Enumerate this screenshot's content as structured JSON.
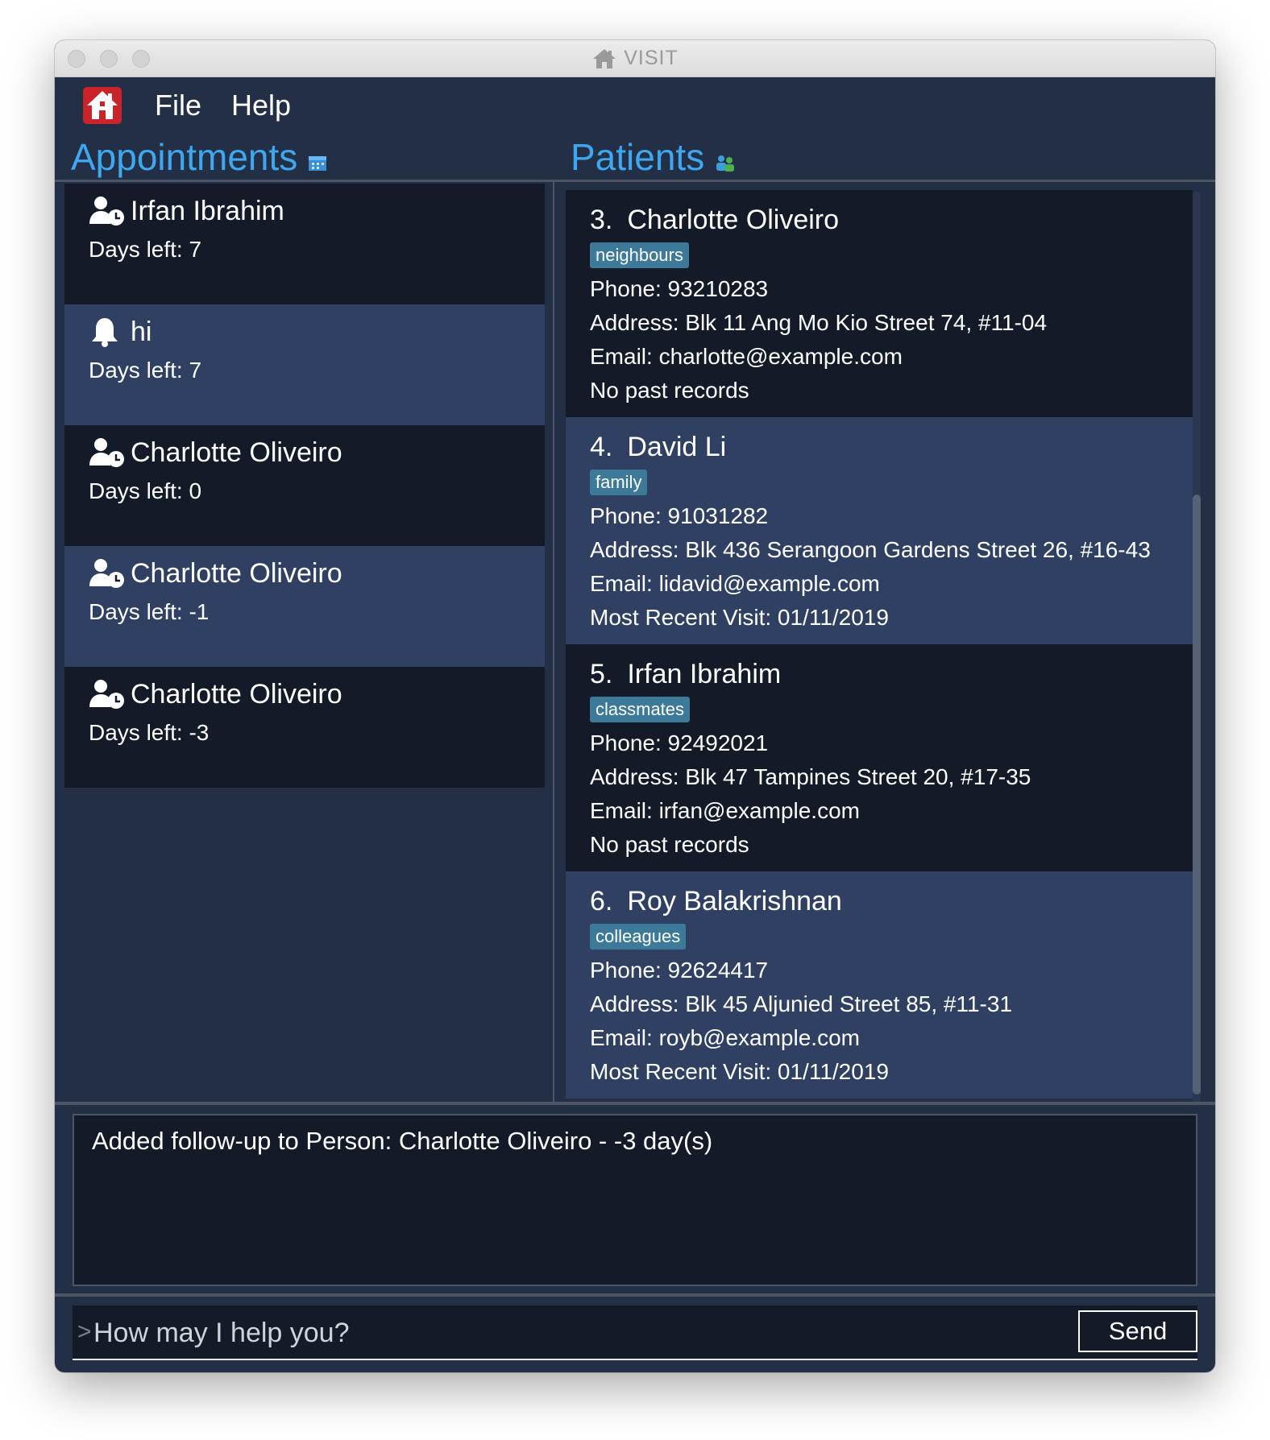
{
  "window": {
    "title": "VISIT"
  },
  "menu": {
    "items": [
      "File",
      "Help"
    ]
  },
  "appointments": {
    "title": "Appointments",
    "items": [
      {
        "icon": "user-clock-icon",
        "name": "Irfan Ibrahim",
        "days": "Days left: 7",
        "shade": "dark"
      },
      {
        "icon": "bell-icon",
        "name": "hi",
        "days": "Days left: 7",
        "shade": "light"
      },
      {
        "icon": "user-clock-icon",
        "name": "Charlotte Oliveiro",
        "days": "Days left: 0",
        "shade": "dark"
      },
      {
        "icon": "user-clock-icon",
        "name": "Charlotte Oliveiro",
        "days": "Days left: -1",
        "shade": "light"
      },
      {
        "icon": "user-clock-icon",
        "name": "Charlotte Oliveiro",
        "days": "Days left: -3",
        "shade": "dark"
      }
    ]
  },
  "patients": {
    "title": "Patients",
    "items": [
      {
        "num": "3.",
        "name": "Charlotte Oliveiro",
        "tag": "neighbours",
        "phone": "Phone: 93210283",
        "address": "Address: Blk 11 Ang Mo Kio Street 74, #11-04",
        "email": "Email: charlotte@example.com",
        "record": "No past records",
        "shade": "dark"
      },
      {
        "num": "4.",
        "name": "David Li",
        "tag": "family",
        "phone": "Phone: 91031282",
        "address": "Address: Blk 436 Serangoon Gardens Street 26, #16-43",
        "email": "Email: lidavid@example.com",
        "record": "Most Recent Visit: 01/11/2019",
        "shade": "light"
      },
      {
        "num": "5.",
        "name": "Irfan Ibrahim",
        "tag": "classmates",
        "phone": "Phone: 92492021",
        "address": "Address: Blk 47 Tampines Street 20, #17-35",
        "email": "Email: irfan@example.com",
        "record": "No past records",
        "shade": "dark"
      },
      {
        "num": "6.",
        "name": "Roy Balakrishnan",
        "tag": "colleagues",
        "phone": "Phone: 92624417",
        "address": "Address: Blk 45 Aljunied Street 85, #11-31",
        "email": "Email: royb@example.com",
        "record": "Most Recent Visit: 01/11/2019",
        "shade": "light"
      }
    ]
  },
  "result": {
    "text": "Added follow-up to Person: Charlotte Oliveiro - -3 day(s)"
  },
  "command": {
    "prompt": ">",
    "placeholder": "How may I help you?",
    "value": "",
    "send_label": "Send"
  },
  "colors": {
    "background": "#232f45",
    "card_dark": "#131a28",
    "card_light": "#2f4063",
    "accent": "#3ea7f0",
    "tag": "#3d7a99",
    "app_icon": "#c8242a"
  }
}
